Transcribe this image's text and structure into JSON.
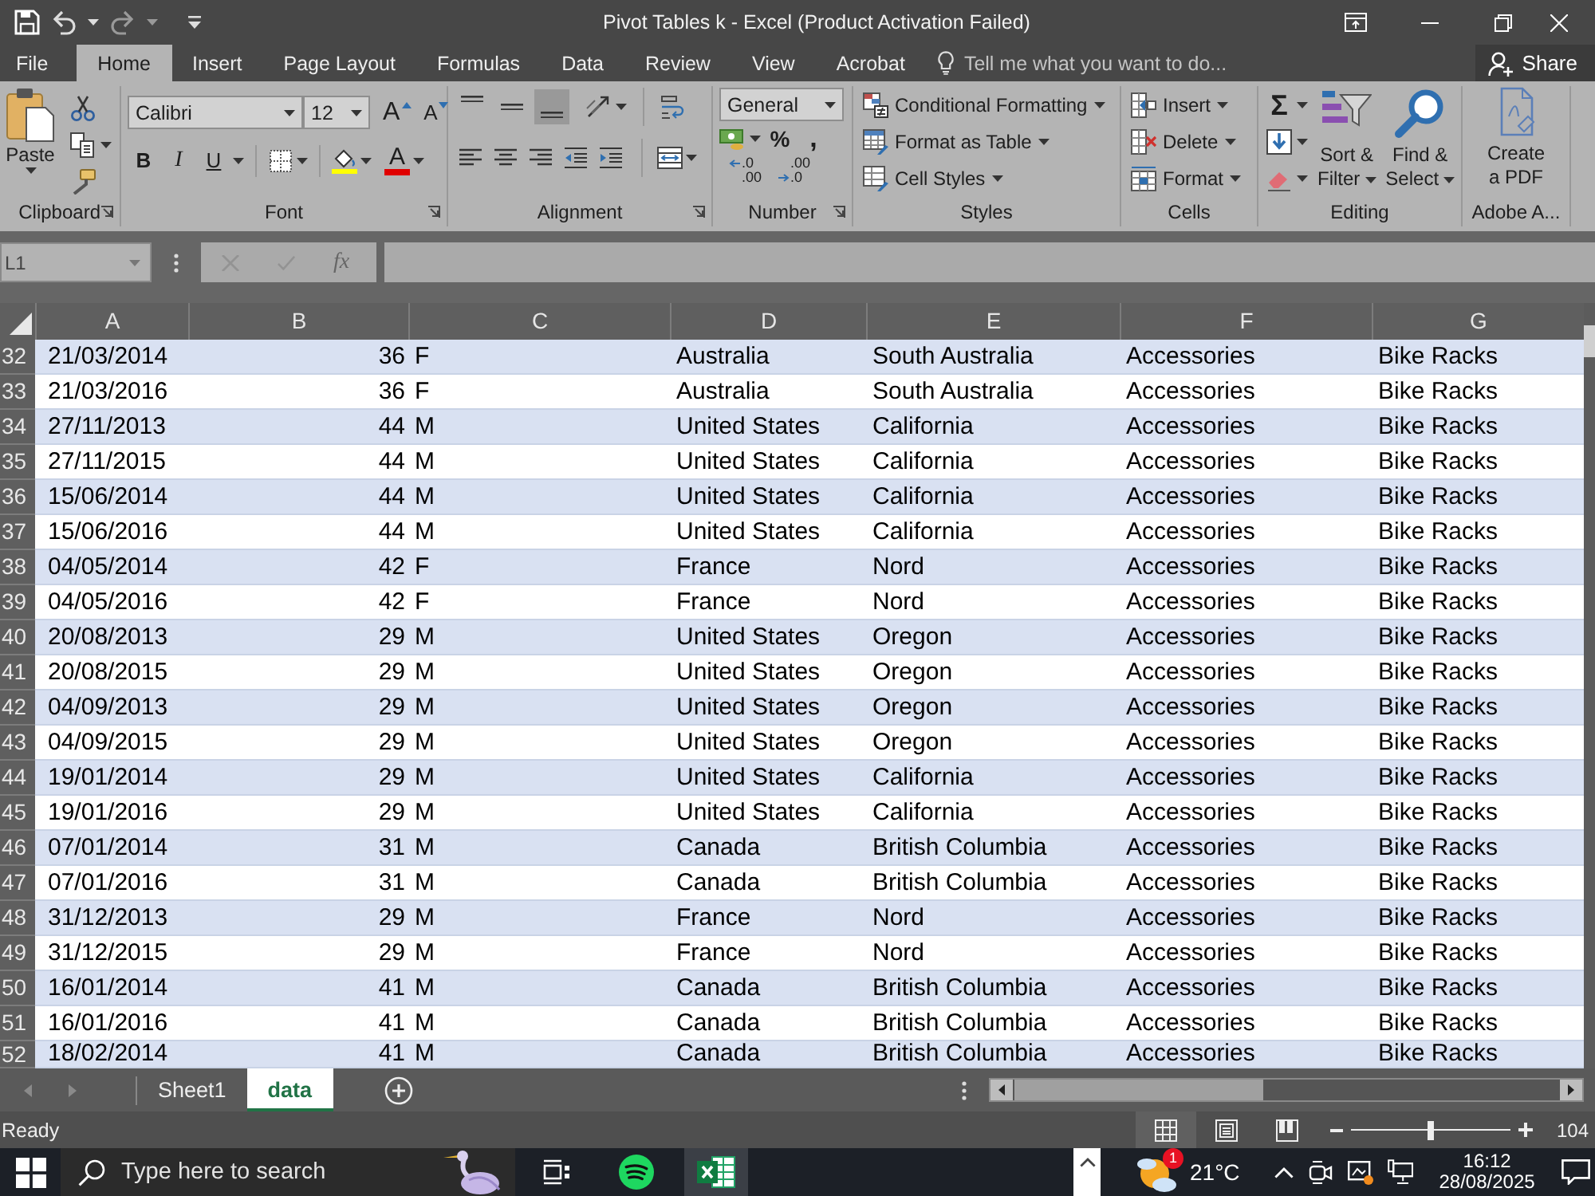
{
  "window": {
    "title": "Pivot Tables k - Excel (Product Activation Failed)"
  },
  "ribbon_tabs": [
    {
      "label": "File",
      "selected": false
    },
    {
      "label": "Home",
      "selected": true
    },
    {
      "label": "Insert",
      "selected": false
    },
    {
      "label": "Page Layout",
      "selected": false
    },
    {
      "label": "Formulas",
      "selected": false
    },
    {
      "label": "Data",
      "selected": false
    },
    {
      "label": "Review",
      "selected": false
    },
    {
      "label": "View",
      "selected": false
    },
    {
      "label": "Acrobat",
      "selected": false
    }
  ],
  "tell_me": {
    "placeholder": "Tell me what you want to do..."
  },
  "share": {
    "label": "Share"
  },
  "ribbon_groups": [
    {
      "kind": "clipboard",
      "title": "Clipboard",
      "paste": "Paste"
    },
    {
      "kind": "font",
      "title": "Font",
      "font_name": "Calibri",
      "font_size": "12",
      "size_buttons": [
        {
          "kind": "grow",
          "glyph": "A"
        },
        {
          "kind": "shrink",
          "glyph": "A"
        }
      ],
      "style_buttons": [
        {
          "kind": "bold",
          "glyph": "B"
        },
        {
          "kind": "italic",
          "glyph": "I"
        },
        {
          "kind": "underline",
          "glyph": "U"
        }
      ],
      "font_color": "A"
    },
    {
      "kind": "alignment",
      "title": "Alignment",
      "vertical_align": [
        {
          "kind": "top",
          "selected": false
        },
        {
          "kind": "middle",
          "selected": false
        },
        {
          "kind": "bottom",
          "selected": true
        }
      ]
    },
    {
      "kind": "number",
      "title": "Number",
      "format": "General",
      "symbols": [
        {
          "kind": "percent",
          "glyph": "%"
        },
        {
          "kind": "comma",
          "glyph": ","
        }
      ],
      "decimals": [
        {
          "kind": "increase",
          "lines": [
            ".0",
            ".00"
          ]
        },
        {
          "kind": "decrease",
          "lines": [
            ".00",
            ".0"
          ]
        }
      ]
    },
    {
      "kind": "styles",
      "title": "Styles",
      "items": [
        {
          "kind": "conditional",
          "label": "Conditional Formatting"
        },
        {
          "kind": "table",
          "label": "Format as Table"
        },
        {
          "kind": "cell_styles",
          "label": "Cell Styles"
        }
      ]
    },
    {
      "kind": "cells",
      "title": "Cells",
      "items": [
        {
          "kind": "insert",
          "label": "Insert"
        },
        {
          "kind": "delete",
          "label": "Delete"
        },
        {
          "kind": "format",
          "label": "Format"
        }
      ]
    },
    {
      "kind": "editing",
      "title": "Editing",
      "autosum": "Σ",
      "large": [
        {
          "kind": "sort",
          "lines": [
            "Sort &",
            "Filter"
          ]
        },
        {
          "kind": "find",
          "lines": [
            "Find &",
            "Select"
          ]
        }
      ]
    },
    {
      "kind": "adobe",
      "title": "Adobe A...",
      "lines": [
        "Create",
        "a PDF"
      ]
    }
  ],
  "formula_bar": {
    "name_box": "L1",
    "fx": "fx"
  },
  "sheet": {
    "columns": [
      {
        "label": "A",
        "kind": "text"
      },
      {
        "label": "B",
        "kind": "number"
      },
      {
        "label": "C",
        "kind": "text"
      },
      {
        "label": "D",
        "kind": "text"
      },
      {
        "label": "E",
        "kind": "text"
      },
      {
        "label": "F",
        "kind": "text"
      },
      {
        "label": "G",
        "kind": "text"
      }
    ],
    "rows": [
      {
        "number": "32",
        "cells": [
          "21/03/2014",
          "36",
          "F",
          "Australia",
          "South Australia",
          "Accessories",
          "Bike Racks"
        ]
      },
      {
        "number": "33",
        "cells": [
          "21/03/2016",
          "36",
          "F",
          "Australia",
          "South Australia",
          "Accessories",
          "Bike Racks"
        ]
      },
      {
        "number": "34",
        "cells": [
          "27/11/2013",
          "44",
          "M",
          "United States",
          "California",
          "Accessories",
          "Bike Racks"
        ]
      },
      {
        "number": "35",
        "cells": [
          "27/11/2015",
          "44",
          "M",
          "United States",
          "California",
          "Accessories",
          "Bike Racks"
        ]
      },
      {
        "number": "36",
        "cells": [
          "15/06/2014",
          "44",
          "M",
          "United States",
          "California",
          "Accessories",
          "Bike Racks"
        ]
      },
      {
        "number": "37",
        "cells": [
          "15/06/2016",
          "44",
          "M",
          "United States",
          "California",
          "Accessories",
          "Bike Racks"
        ]
      },
      {
        "number": "38",
        "cells": [
          "04/05/2014",
          "42",
          "F",
          "France",
          "Nord",
          "Accessories",
          "Bike Racks"
        ]
      },
      {
        "number": "39",
        "cells": [
          "04/05/2016",
          "42",
          "F",
          "France",
          "Nord",
          "Accessories",
          "Bike Racks"
        ]
      },
      {
        "number": "40",
        "cells": [
          "20/08/2013",
          "29",
          "M",
          "United States",
          "Oregon",
          "Accessories",
          "Bike Racks"
        ]
      },
      {
        "number": "41",
        "cells": [
          "20/08/2015",
          "29",
          "M",
          "United States",
          "Oregon",
          "Accessories",
          "Bike Racks"
        ]
      },
      {
        "number": "42",
        "cells": [
          "04/09/2013",
          "29",
          "M",
          "United States",
          "Oregon",
          "Accessories",
          "Bike Racks"
        ]
      },
      {
        "number": "43",
        "cells": [
          "04/09/2015",
          "29",
          "M",
          "United States",
          "Oregon",
          "Accessories",
          "Bike Racks"
        ]
      },
      {
        "number": "44",
        "cells": [
          "19/01/2014",
          "29",
          "M",
          "United States",
          "California",
          "Accessories",
          "Bike Racks"
        ]
      },
      {
        "number": "45",
        "cells": [
          "19/01/2016",
          "29",
          "M",
          "United States",
          "California",
          "Accessories",
          "Bike Racks"
        ]
      },
      {
        "number": "46",
        "cells": [
          "07/01/2014",
          "31",
          "M",
          "Canada",
          "British Columbia",
          "Accessories",
          "Bike Racks"
        ]
      },
      {
        "number": "47",
        "cells": [
          "07/01/2016",
          "31",
          "M",
          "Canada",
          "British Columbia",
          "Accessories",
          "Bike Racks"
        ]
      },
      {
        "number": "48",
        "cells": [
          "31/12/2013",
          "29",
          "M",
          "France",
          "Nord",
          "Accessories",
          "Bike Racks"
        ]
      },
      {
        "number": "49",
        "cells": [
          "31/12/2015",
          "29",
          "M",
          "France",
          "Nord",
          "Accessories",
          "Bike Racks"
        ]
      },
      {
        "number": "50",
        "cells": [
          "16/01/2014",
          "41",
          "M",
          "Canada",
          "British Columbia",
          "Accessories",
          "Bike Racks"
        ]
      },
      {
        "number": "51",
        "cells": [
          "16/01/2016",
          "41",
          "M",
          "Canada",
          "British Columbia",
          "Accessories",
          "Bike Racks"
        ]
      },
      {
        "number": "52",
        "cells": [
          "18/02/2014",
          "41",
          "M",
          "Canada",
          "British Columbia",
          "Accessories",
          "Bike Racks"
        ]
      }
    ]
  },
  "sheet_tabs": [
    {
      "label": "Sheet1",
      "selected": false
    },
    {
      "label": "data",
      "selected": true
    }
  ],
  "status_bar": {
    "text": "Ready",
    "views": [
      {
        "kind": "normal",
        "selected": true
      },
      {
        "kind": "page_layout",
        "selected": false
      },
      {
        "kind": "page_break",
        "selected": false
      }
    ],
    "zoom": {
      "level": 0.5,
      "reading": "104"
    }
  },
  "taskbar": {
    "search": {
      "placeholder": "Type here to search"
    },
    "apps": [
      {
        "kind": "task_view",
        "selected": false
      },
      {
        "kind": "spotify",
        "selected": false
      },
      {
        "kind": "excel",
        "selected": true
      }
    ],
    "weather": {
      "badge": "1",
      "temperature": "21°C"
    },
    "clock": {
      "time": "16:12",
      "date": "28/08/2025"
    }
  }
}
